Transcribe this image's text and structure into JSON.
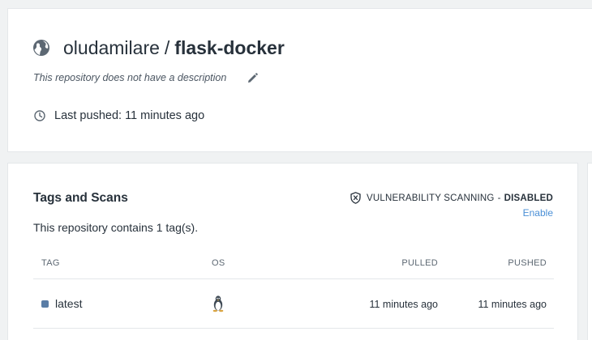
{
  "repository": {
    "namespace": "oludamilare",
    "separator": "/",
    "name": "flask-docker",
    "description": "This repository does not have a description",
    "last_pushed": "Last pushed: 11 minutes ago",
    "icons": {
      "visibility": "globe-icon",
      "edit": "pencil-icon",
      "time": "clock-icon"
    }
  },
  "tags_section": {
    "title": "Tags and Scans",
    "count_text": "This repository contains 1 tag(s).",
    "vulnerability": {
      "label": "VULNERABILITY SCANNING",
      "dash": "-",
      "status": "DISABLED",
      "enable_label": "Enable",
      "icon": "shield-x-icon"
    },
    "columns": [
      "TAG",
      "OS",
      "PULLED",
      "PUSHED"
    ],
    "rows": [
      {
        "tag": "latest",
        "os_icon": "linux-icon",
        "pulled": "11 minutes ago",
        "pushed": "11 minutes ago"
      }
    ]
  },
  "colors": {
    "background": "#f0f2f3",
    "card": "#ffffff",
    "text": "#27313b",
    "link": "#4a8fd6",
    "tag_marker": "#5a7da6"
  }
}
